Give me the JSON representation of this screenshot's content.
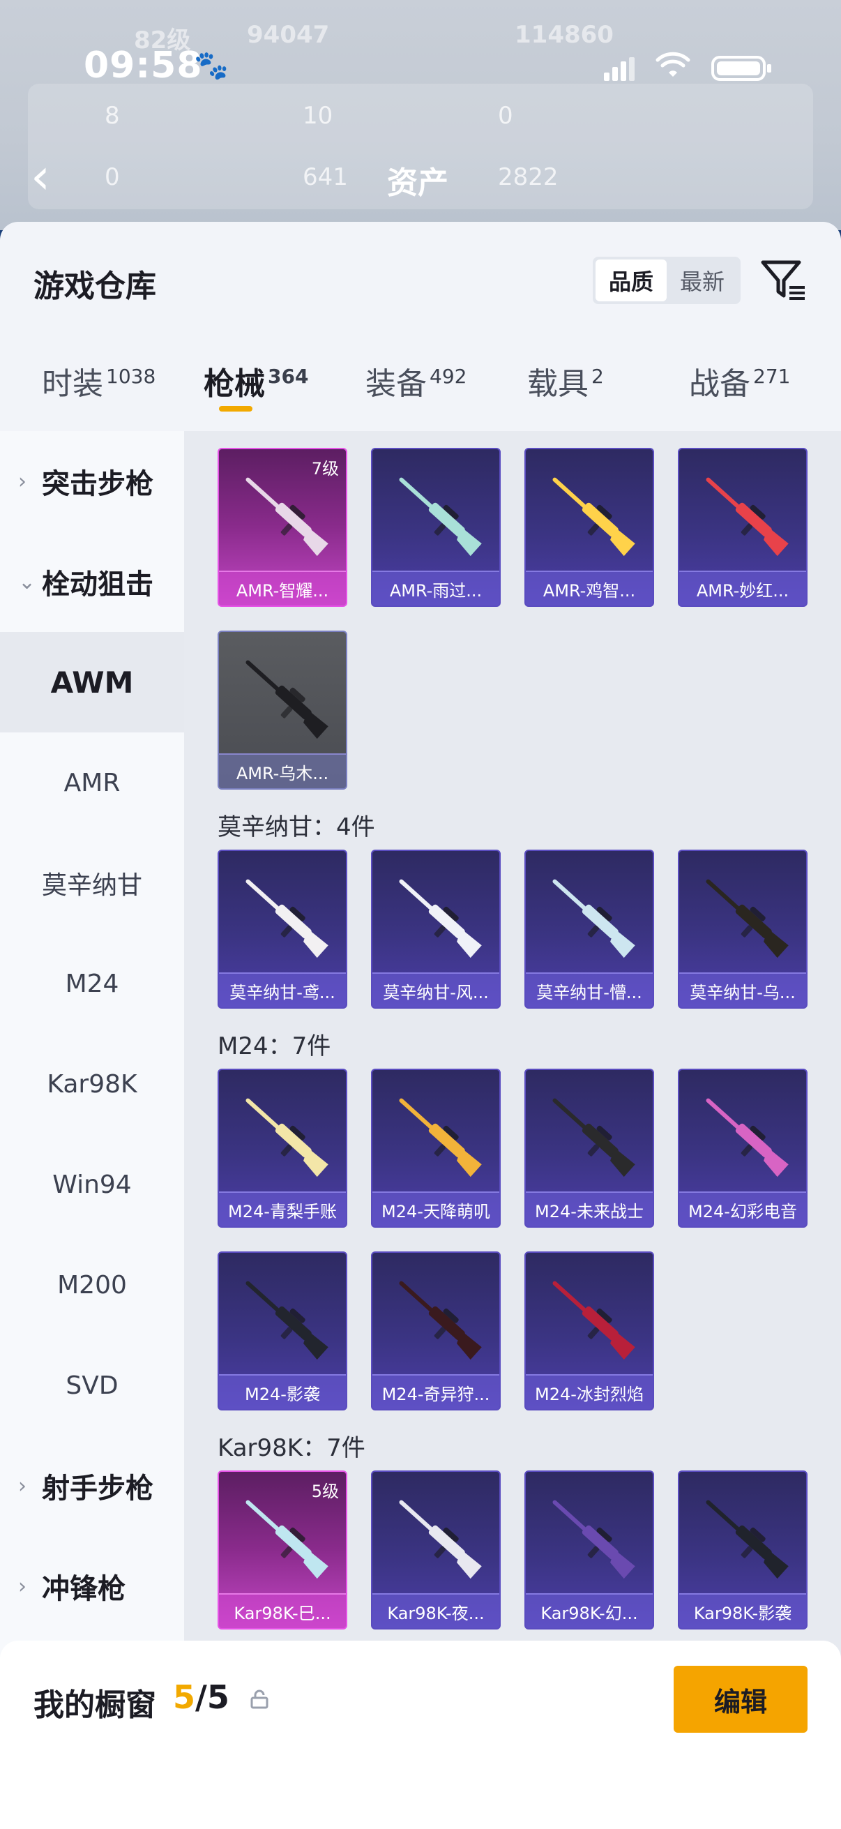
{
  "status_bar": {
    "time": "09:58"
  },
  "background_header": {
    "level_text": "82级",
    "heat_value": "94047",
    "score_value": "114860",
    "stat_1": "8",
    "stat_2": "10",
    "stat_3": "0",
    "stat_4": "0",
    "stat_5": "641",
    "stat_6": "2822",
    "title": "资产"
  },
  "sheet": {
    "title": "游戏仓库",
    "sort_options": [
      "品质",
      "最新"
    ],
    "sort_active": "品质"
  },
  "tabs": [
    {
      "label": "时装",
      "count": "1038"
    },
    {
      "label": "枪械",
      "count": "364"
    },
    {
      "label": "装备",
      "count": "492"
    },
    {
      "label": "载具",
      "count": "2"
    },
    {
      "label": "战备",
      "count": "271"
    }
  ],
  "sidebar": {
    "items": [
      {
        "label": "突击步枪",
        "type": "group",
        "chevron": "›"
      },
      {
        "label": "栓动狙击",
        "type": "group",
        "chevron": "⌄"
      },
      {
        "label": "AWM",
        "type": "sub",
        "selected": true
      },
      {
        "label": "AMR",
        "type": "sub"
      },
      {
        "label": "莫辛纳甘",
        "type": "sub"
      },
      {
        "label": "M24",
        "type": "sub"
      },
      {
        "label": "Kar98K",
        "type": "sub"
      },
      {
        "label": "Win94",
        "type": "sub"
      },
      {
        "label": "M200",
        "type": "sub"
      },
      {
        "label": "SVD",
        "type": "sub"
      },
      {
        "label": "射手步枪",
        "type": "group",
        "chevron": "›"
      },
      {
        "label": "冲锋枪",
        "type": "group",
        "chevron": "›"
      }
    ]
  },
  "sections": [
    {
      "title": "",
      "items": [
        {
          "name": "AMR-智耀...",
          "level": "7级",
          "style": "pink",
          "gun_color": "#e8d8e8"
        },
        {
          "name": "AMR-雨过...",
          "style": "purple",
          "gun_color": "#a9e0d8"
        },
        {
          "name": "AMR-鸡智...",
          "style": "purple",
          "gun_color": "#ffd24a"
        },
        {
          "name": "AMR-妙红...",
          "style": "purple",
          "gun_color": "#e8424a"
        },
        {
          "name": "AMR-乌木...",
          "style": "gray",
          "gun_color": "#1e1e22"
        }
      ]
    },
    {
      "title": "莫辛纳甘：4件",
      "items": [
        {
          "name": "莫辛纳甘-鸢...",
          "style": "purple",
          "gun_color": "#f2f0f2"
        },
        {
          "name": "莫辛纳甘-风...",
          "style": "purple",
          "gun_color": "#f0f2f8"
        },
        {
          "name": "莫辛纳甘-懵...",
          "style": "purple",
          "gun_color": "#cde6f0"
        },
        {
          "name": "莫辛纳甘-乌...",
          "style": "purple",
          "gun_color": "#2a2620"
        }
      ]
    },
    {
      "title": "M24：7件",
      "items": [
        {
          "name": "M24-青梨手账",
          "style": "purple",
          "gun_color": "#f3e6a8"
        },
        {
          "name": "M24-天降萌叽",
          "style": "purple",
          "gun_color": "#f2b33a"
        },
        {
          "name": "M24-未来战士",
          "style": "purple",
          "gun_color": "#2a2a2c"
        },
        {
          "name": "M24-幻彩电音",
          "style": "purple",
          "gun_color": "#d864c4"
        },
        {
          "name": "M24-影袭",
          "style": "purple",
          "gun_color": "#22252e"
        },
        {
          "name": "M24-奇异狩...",
          "style": "purple",
          "gun_color": "#3a1a1e"
        },
        {
          "name": "M24-冰封烈焰",
          "style": "purple",
          "gun_color": "#b8203a"
        }
      ]
    },
    {
      "title": "Kar98K：7件",
      "items": [
        {
          "name": "Kar98K-巳...",
          "level": "5级",
          "style": "pink",
          "gun_color": "#bfe6f0"
        },
        {
          "name": "Kar98K-夜...",
          "style": "purple",
          "gun_color": "#e8e8f0"
        },
        {
          "name": "Kar98K-幻...",
          "style": "purple",
          "gun_color": "#6a4ab0"
        },
        {
          "name": "Kar98K-影袭",
          "style": "purple",
          "gun_color": "#20232c"
        }
      ]
    }
  ],
  "bottom_bar": {
    "label": "我的橱窗",
    "count_current": "5",
    "count_sep": "/",
    "count_total": "5",
    "edit_label": "编辑"
  }
}
